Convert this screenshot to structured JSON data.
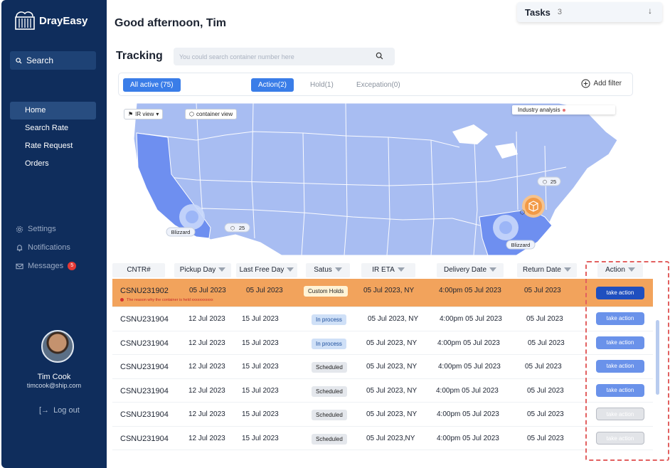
{
  "sidebar": {
    "brand": "DrayEasy",
    "search_label": "Search",
    "nav": [
      {
        "label": "Home",
        "active": true
      },
      {
        "label": "Search Rate",
        "active": false
      },
      {
        "label": "Rate Request",
        "active": false
      },
      {
        "label": "Orders",
        "active": false
      }
    ],
    "secondary": [
      {
        "label": "Settings",
        "icon": "gear-icon"
      },
      {
        "label": "Notifications",
        "icon": "bell-icon"
      },
      {
        "label": "Messages",
        "icon": "mail-icon",
        "badge": "5"
      }
    ],
    "user": {
      "name": "Tim Cook",
      "email": "timcook@ship.com"
    },
    "logout_label": "Log out"
  },
  "header": {
    "greeting": "Good afternoon, Tim",
    "tasks_label": "Tasks",
    "tasks_count": "3"
  },
  "tracking": {
    "title": "Tracking",
    "search_placeholder": "You could search container number here"
  },
  "filters": {
    "all_active": "All active (75)",
    "action": "Action(2)",
    "hold": "Hold(1)",
    "exception": "Excepation(0)",
    "add_filter": "Add filter"
  },
  "map": {
    "ir_view": "IR view",
    "container_view": "container view",
    "industry_analysis": "Industry analysis",
    "markers": [
      {
        "label": "Blizzard"
      },
      {
        "label": "25"
      },
      {
        "label": "25"
      },
      {
        "label": "Blizzard"
      }
    ]
  },
  "table": {
    "headers": [
      "CNTR#",
      "Pickup Day",
      "Last Free Day",
      "Satus",
      "IR ETA",
      "Delivery Date",
      "Return Date",
      "Action"
    ],
    "rows": [
      {
        "cntr": "CSNU231902",
        "pickup": "05 Jul 2023",
        "lfd": "05 Jul 2023",
        "status": "Custom Holds",
        "status_kind": "custom",
        "eta": "05 Jul 2023, NY",
        "delivery": "4:00pm 05 Jul 2023",
        "ret": "05 Jul 2023",
        "action": "take action",
        "action_kind": "dark",
        "note": "The reason why the container is held xxxxxxxxxxx"
      },
      {
        "cntr": "CSNU231904",
        "pickup": "12 Jul 2023",
        "lfd": "15 Jul 2023",
        "status": "In process",
        "status_kind": "inproc",
        "eta": "05 Jul 2023, NY",
        "delivery": "4:00pm 05 Jul 2023",
        "ret": "05 Jul 2023",
        "action": "take action",
        "action_kind": "primary"
      },
      {
        "cntr": "CSNU231904",
        "pickup": "12 Jul 2023",
        "lfd": "15 Jul 2023",
        "status": "In process",
        "status_kind": "inproc",
        "eta": "05 Jul 2023, NY",
        "delivery": "4:00pm 05 Jul 2023",
        "ret": "05 Jul 2023",
        "action": "take action",
        "action_kind": "primary"
      },
      {
        "cntr": "CSNU231904",
        "pickup": "12 Jul 2023",
        "lfd": "15 Jul 2023",
        "status": "Scheduled",
        "status_kind": "sched",
        "eta": "05 Jul 2023, NY",
        "delivery": "4:00pm 05 Jul 2023",
        "ret": "05 Jul 2023",
        "action": "take action",
        "action_kind": "primary"
      },
      {
        "cntr": "CSNU231904",
        "pickup": "12 Jul 2023",
        "lfd": "15 Jul 2023",
        "status": "Scheduled",
        "status_kind": "sched",
        "eta": "05 Jul 2023, NY",
        "delivery": "4:00pm 05 Jul 2023",
        "ret": "05 Jul 2023",
        "action": "take action",
        "action_kind": "primary"
      },
      {
        "cntr": "CSNU231904",
        "pickup": "12 Jul 2023",
        "lfd": "15 Jul 2023",
        "status": "Scheduled",
        "status_kind": "sched",
        "eta": "05 Jul 2023, NY",
        "delivery": "4:00pm 05 Jul 2023",
        "ret": "05 Jul 2023",
        "action": "take action",
        "action_kind": "disabled"
      },
      {
        "cntr": "CSNU231904",
        "pickup": "12 Jul 2023",
        "lfd": "15 Jul 2023",
        "status": "Scheduled",
        "status_kind": "sched",
        "eta": "05 Jul 2023,NY",
        "delivery": "4:00pm 05 Jul 2023",
        "ret": "05 Jul 2023",
        "action": "take action",
        "action_kind": "disabled"
      }
    ]
  },
  "colors": {
    "sidebar": "#0f2d5c",
    "accent": "#3a7de8",
    "highlight_row": "#f2a35c",
    "map_state": "#a8bdf2",
    "map_focus": "#6e8ff0"
  }
}
